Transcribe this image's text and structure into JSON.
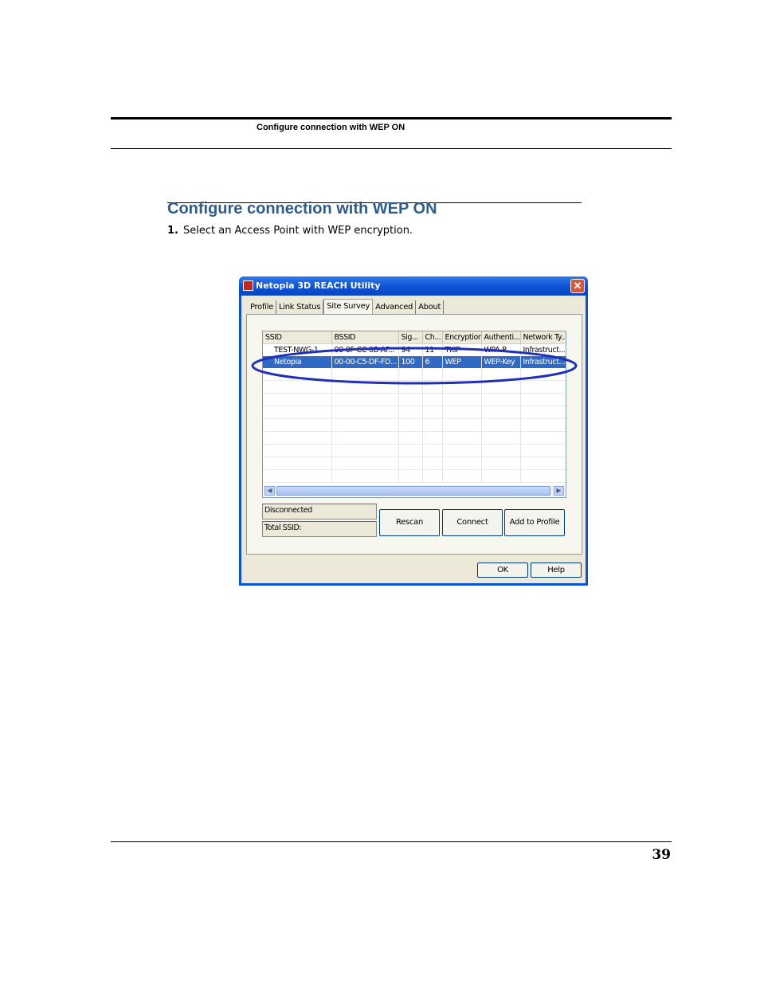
{
  "header": {
    "running_title": "Configure connection with WEP ON"
  },
  "section": {
    "title": "Configure connection with WEP ON",
    "step_number": "1.",
    "step_text": "Select an Access Point with WEP encryption."
  },
  "dialog": {
    "title": "Netopia 3D REACH Utility",
    "close": "✕",
    "tabs": [
      "Profile",
      "Link Status",
      "Site Survey",
      "Advanced",
      "About"
    ],
    "active_tab": "Site Survey",
    "columns": [
      "SSID",
      "BSSID",
      "Sig...",
      "Ch...",
      "Encryption",
      "Authenti...",
      "Network Ty..."
    ],
    "rows": [
      {
        "ssid": "TEST-NWG-1...",
        "bssid": "00-0F-CC-0B-AF...",
        "signal": "94",
        "channel": "11",
        "encryption": "TKIP",
        "auth": "WPA-P...",
        "network": "Infrastruct..."
      },
      {
        "ssid": "Netopia",
        "bssid": "00-00-C5-DF-FD...",
        "signal": "100",
        "channel": "6",
        "encryption": "WEP",
        "auth": "WEP-Key",
        "network": "Infrastruct..."
      }
    ],
    "selected_row": 1,
    "status": "Disconnected",
    "total_ssid": "Total SSID:",
    "buttons": {
      "rescan": "Rescan",
      "connect": "Connect",
      "add_to_profile": "Add to Profile",
      "ok": "OK",
      "help": "Help"
    },
    "highlight_color": "#1f2fb8"
  },
  "footer": {
    "page_number": "39"
  }
}
